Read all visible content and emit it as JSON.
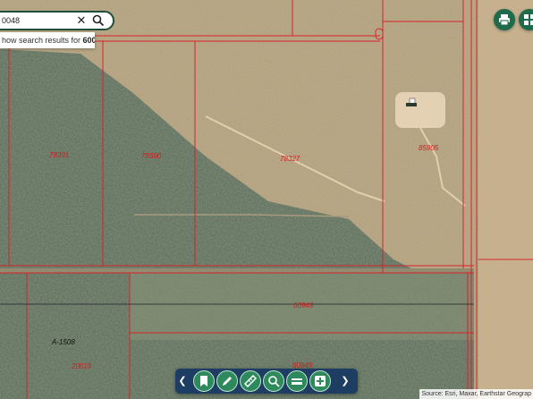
{
  "search": {
    "value": "0048",
    "suggestion_prefix": "how search results for ",
    "suggestion_bold": "600..."
  },
  "parcels": [
    "78391",
    "78390",
    "78327",
    "85905",
    "60949",
    "60949"
  ],
  "survey_label": "A-1508",
  "attribution": "Source: Esri, Maxar, Earthstar Geograp",
  "icons": {
    "print": "printer-icon",
    "layers": "grid-icon",
    "toolbar": [
      "bookmark-icon",
      "draw-icon",
      "measure-icon",
      "identify-icon",
      "basemap-icon",
      "add-data-icon"
    ]
  },
  "colors": {
    "parcel_line": "#d8232a",
    "toolbar": "#1e3d63",
    "button": "#2e8a5c"
  }
}
